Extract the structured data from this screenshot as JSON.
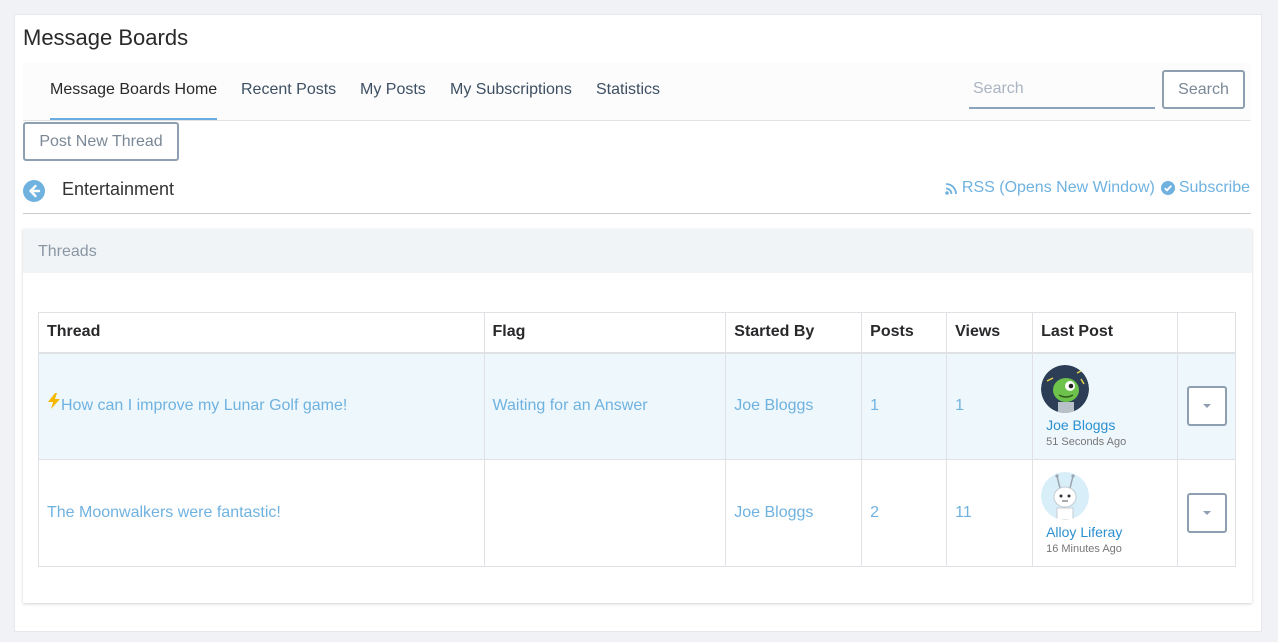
{
  "app": {
    "title": "Message Boards"
  },
  "nav": {
    "items": [
      {
        "label": "Message Boards Home"
      },
      {
        "label": "Recent Posts"
      },
      {
        "label": "My Posts"
      },
      {
        "label": "My Subscriptions"
      },
      {
        "label": "Statistics"
      }
    ],
    "active_index": 0
  },
  "search": {
    "placeholder": "Search",
    "button_label": "Search"
  },
  "toolbar": {
    "post_new_thread_label": "Post New Thread"
  },
  "category": {
    "title": "Entertainment",
    "rss_label": "RSS (Opens New Window)",
    "subscribe_label": "Subscribe"
  },
  "panel": {
    "title": "Threads"
  },
  "table": {
    "columns": [
      "Thread",
      "Flag",
      "Started By",
      "Posts",
      "Views",
      "Last Post",
      ""
    ],
    "rows": [
      {
        "thread": "How can I improve my Lunar Golf game!",
        "flag": "Waiting for an Answer",
        "started_by": "Joe Bloggs",
        "posts": "1",
        "views": "1",
        "last_post_user": "Joe Bloggs",
        "last_post_time": "51 Seconds Ago",
        "highlighted": true
      },
      {
        "thread": "The Moonwalkers were fantastic!",
        "flag": "",
        "started_by": "Joe Bloggs",
        "posts": "2",
        "views": "11",
        "last_post_user": "Alloy Liferay",
        "last_post_time": "16 Minutes Ago",
        "highlighted": false
      }
    ]
  },
  "colors": {
    "accent": "#6fb2e0",
    "link_dark": "#2b8fd0",
    "highlight_row": "#eef7fc",
    "bolt": "#f5b800"
  },
  "icons": [
    "arrow-left-circle-icon",
    "rss-icon",
    "check-circle-icon",
    "bolt-icon",
    "caret-down-icon"
  ]
}
